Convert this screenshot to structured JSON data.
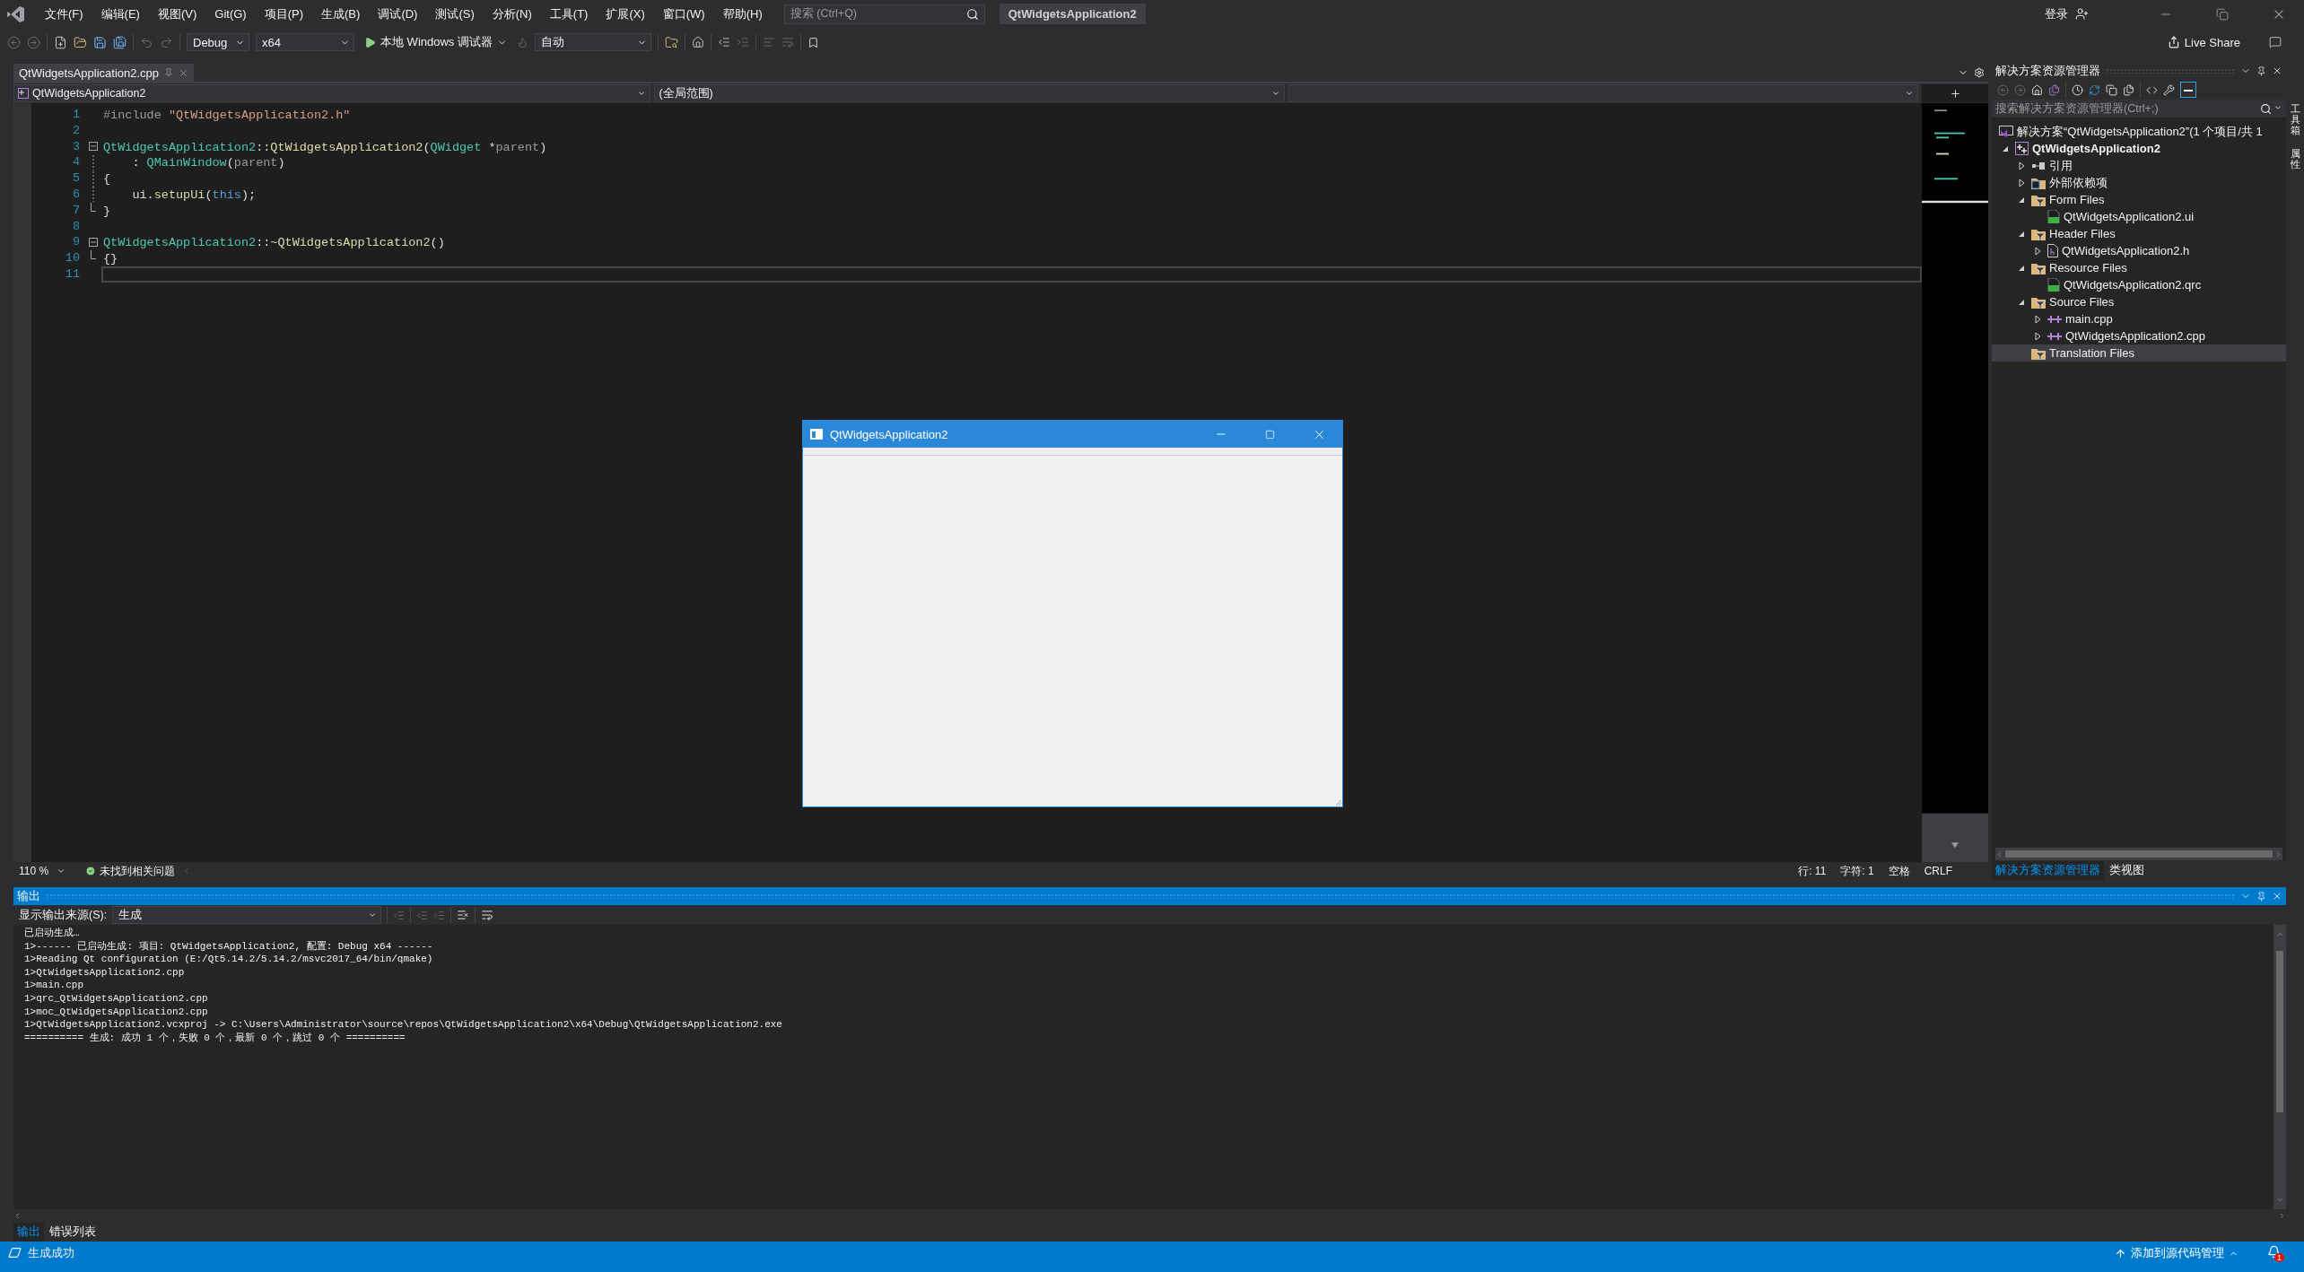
{
  "menu_bar": {
    "items": [
      "文件(F)",
      "编辑(E)",
      "视图(V)",
      "Git(G)",
      "项目(P)",
      "生成(B)",
      "调试(D)",
      "测试(S)",
      "分析(N)",
      "工具(T)",
      "扩展(X)",
      "窗口(W)",
      "帮助(H)"
    ],
    "search": {
      "placeholder": "搜索 (Ctrl+Q)"
    },
    "solution_title": "QtWidgetsApplication2",
    "sign_in": "登录"
  },
  "toolbar": {
    "configuration": "Debug",
    "platform": "x64",
    "start": "本地 Windows 调试器",
    "debug_target": "自动",
    "live_share": "Live Share"
  },
  "editor": {
    "tabs": [
      {
        "label": "QtWidgetsApplication2.cpp",
        "selected": true
      }
    ],
    "project_scope": "QtWidgetsApplication2",
    "function_scope": "(全局范围)",
    "lines": [
      {
        "number": "1",
        "kind": "plain",
        "current": false,
        "tokens": [
          {
            "kind": "preproc",
            "text": "#include "
          },
          {
            "kind": "string",
            "text": "\"QtWidgetsApplication2.h\""
          }
        ]
      },
      {
        "number": "2",
        "kind": "plain",
        "current": false
      },
      {
        "number": "3",
        "kind": "fold_start",
        "current": false,
        "tokens": [
          {
            "kind": "type",
            "text": "QtWidgetsApplication2"
          },
          {
            "kind": "plain",
            "text": "::"
          },
          {
            "kind": "func",
            "text": "QtWidgetsApplication2"
          },
          {
            "kind": "plain",
            "text": "("
          },
          {
            "kind": "type",
            "text": "QWidget"
          },
          {
            "kind": "plain",
            "text": " *"
          },
          {
            "kind": "param",
            "text": "parent"
          },
          {
            "kind": "plain",
            "text": ")"
          }
        ]
      },
      {
        "number": "4",
        "kind": "fold_body",
        "current": false,
        "tokens": [
          {
            "kind": "plain",
            "text": "    : "
          },
          {
            "kind": "type",
            "text": "QMainWindow"
          },
          {
            "kind": "plain",
            "text": "("
          },
          {
            "kind": "param",
            "text": "parent"
          },
          {
            "kind": "plain",
            "text": ")"
          }
        ]
      },
      {
        "number": "5",
        "kind": "fold_body",
        "current": false,
        "tokens": [
          {
            "kind": "plain",
            "text": "{"
          }
        ]
      },
      {
        "number": "6",
        "kind": "fold_body",
        "current": false,
        "tokens": [
          {
            "kind": "plain",
            "text": "    ui."
          },
          {
            "kind": "func",
            "text": "setupUi"
          },
          {
            "kind": "plain",
            "text": "("
          },
          {
            "kind": "keyword",
            "text": "this"
          },
          {
            "kind": "plain",
            "text": ");"
          }
        ]
      },
      {
        "number": "7",
        "kind": "fold_end",
        "current": false,
        "tokens": [
          {
            "kind": "plain",
            "text": "}"
          }
        ]
      },
      {
        "number": "8",
        "kind": "plain",
        "current": false
      },
      {
        "number": "9",
        "kind": "fold_start",
        "current": false,
        "tokens": [
          {
            "kind": "type",
            "text": "QtWidgetsApplication2"
          },
          {
            "kind": "plain",
            "text": "::"
          },
          {
            "kind": "func",
            "text": "~QtWidgetsApplication2"
          },
          {
            "kind": "plain",
            "text": "()"
          }
        ]
      },
      {
        "number": "10",
        "kind": "fold_end",
        "current": false,
        "tokens": [
          {
            "kind": "plain",
            "text": "{}"
          }
        ]
      },
      {
        "number": "11",
        "kind": "plain",
        "current": true
      }
    ],
    "status": {
      "zoom": "110 %",
      "issues": "未找到相关问题",
      "line": "行: 11",
      "column": "字符: 1",
      "indent": "空格",
      "line_ending": "CRLF"
    }
  },
  "solution_explorer": {
    "title": "解决方案资源管理器",
    "search": {
      "placeholder": "搜索解决方案资源管理器(Ctrl+;)"
    },
    "tree": [
      {
        "label": "解决方案“QtWidgetsApplication2”(1 个项目/共 1",
        "kind": "solution",
        "selected": false
      },
      {
        "label": "QtWidgetsApplication2",
        "kind": "project",
        "expanded": true,
        "selected": false,
        "children": [
          {
            "label": "引用",
            "kind": "reference",
            "expanded": false,
            "selected": false
          },
          {
            "label": "外部依赖项",
            "kind": "external",
            "expanded": false,
            "selected": false
          },
          {
            "label": "Form Files",
            "kind": "filter",
            "expanded": true,
            "selected": false,
            "children": [
              {
                "label": "QtWidgetsApplication2.ui",
                "kind": "ui",
                "selected": false
              }
            ]
          },
          {
            "label": "Header Files",
            "kind": "filter",
            "expanded": true,
            "selected": false,
            "children": [
              {
                "label": "QtWidgetsApplication2.h",
                "kind": "header",
                "expanded": false,
                "selected": false
              }
            ]
          },
          {
            "label": "Resource Files",
            "kind": "filter",
            "expanded": true,
            "selected": false,
            "children": [
              {
                "label": "QtWidgetsApplication2.qrc",
                "kind": "qrc",
                "selected": false
              }
            ]
          },
          {
            "label": "Source Files",
            "kind": "filter",
            "expanded": true,
            "selected": false,
            "children": [
              {
                "label": "main.cpp",
                "kind": "cpp",
                "expanded": false,
                "selected": false
              },
              {
                "label": "QtWidgetsApplication2.cpp",
                "kind": "cpp",
                "expanded": false,
                "selected": false
              }
            ]
          },
          {
            "label": "Translation Files",
            "kind": "filter",
            "selected": true
          }
        ]
      }
    ],
    "tabs": [
      {
        "label": "解决方案资源管理器",
        "selected": true
      },
      {
        "label": "类视图",
        "selected": false
      }
    ]
  },
  "side_tabs": [
    "工具箱",
    "属性"
  ],
  "output": {
    "title": "输出",
    "source_label": "显示输出来源(S):",
    "source": "生成",
    "lines": [
      "已启动生成…",
      "1>------ 已启动生成: 项目: QtWidgetsApplication2, 配置: Debug x64 ------",
      "1>Reading Qt configuration (E:/Qt5.14.2/5.14.2/msvc2017_64/bin/qmake)",
      "1>QtWidgetsApplication2.cpp",
      "1>main.cpp",
      "1>qrc_QtWidgetsApplication2.cpp",
      "1>moc_QtWidgetsApplication2.cpp",
      "1>QtWidgetsApplication2.vcxproj -> C:\\Users\\Administrator\\source\\repos\\QtWidgetsApplication2\\x64\\Debug\\QtWidgetsApplication2.exe",
      "========== 生成: 成功 1 个，失败 0 个，最新 0 个，跳过 0 个 =========="
    ],
    "tabs": [
      {
        "label": "输出",
        "selected": true
      },
      {
        "label": "错误列表",
        "selected": false
      }
    ]
  },
  "running_app": {
    "title": "QtWidgetsApplication2"
  },
  "status_bar": {
    "message": "生成成功",
    "source_control": "添加到源代码管理",
    "notifications": "1"
  }
}
